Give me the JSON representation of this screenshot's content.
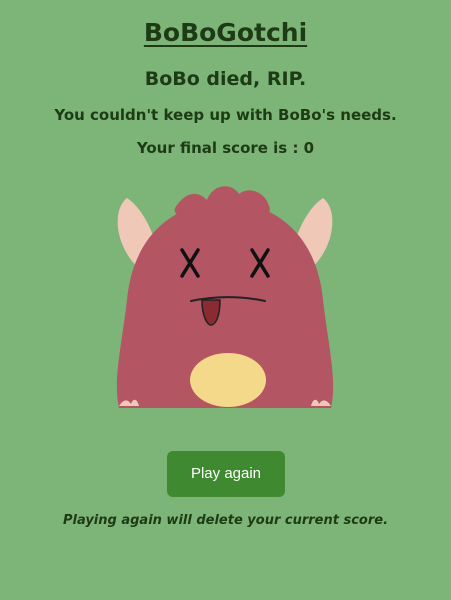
{
  "app": {
    "title": "BoBoGotchi"
  },
  "game_over": {
    "headline": "BoBo died, RIP.",
    "reason": "You couldn't keep up with BoBo's needs.",
    "score_line": "Your final score is : 0"
  },
  "actions": {
    "play_again_label": "Play again",
    "play_again_warning": "Playing again will delete your current score."
  },
  "pet": {
    "name": "BoBo",
    "state": "dead",
    "body_color": "#b35563",
    "belly_color": "#f5d98a",
    "ear_color": "#f0c8b8",
    "eyes_icon": "x-eyes-icon",
    "tongue_color": "#8a2a32"
  },
  "colors": {
    "background": "#7db478",
    "text": "#1d3b14",
    "button": "#3f8a31"
  }
}
